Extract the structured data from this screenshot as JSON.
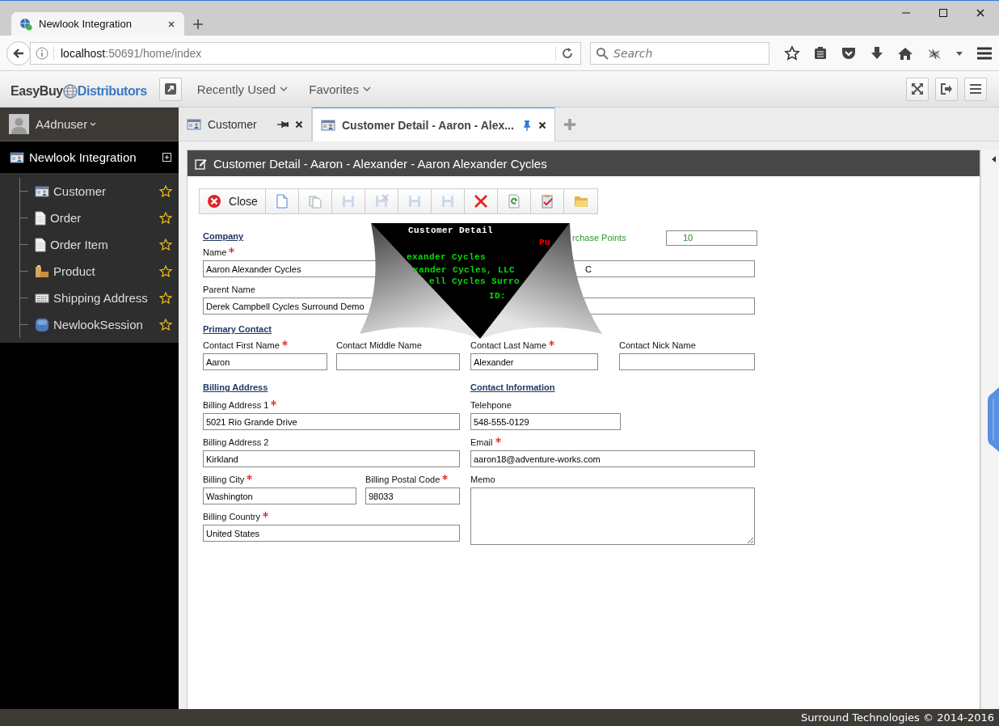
{
  "browser": {
    "tab_title": "Newlook Integration",
    "url_host": "localhost",
    "url_rest": ":50691/home/index",
    "search_placeholder": "Search"
  },
  "header": {
    "logo_left": "EasyBuy",
    "logo_right": "Distributors",
    "menus": [
      "Recently Used",
      "Favorites"
    ]
  },
  "user": {
    "name": "A4dnuser"
  },
  "sidebar": {
    "root": {
      "label": "Newlook Integration"
    },
    "items": [
      {
        "label": "Customer",
        "kind": "customer"
      },
      {
        "label": "Order",
        "kind": "document"
      },
      {
        "label": "Order Item",
        "kind": "document"
      },
      {
        "label": "Product",
        "kind": "boxes"
      },
      {
        "label": "Shipping Address",
        "kind": "keyboard"
      },
      {
        "label": "NewlookSession",
        "kind": "database"
      }
    ]
  },
  "tabs": [
    {
      "label": "Customer",
      "selected": false,
      "pinned": false
    },
    {
      "label": "Customer Detail - Aaron - Alex...",
      "selected": true,
      "pinned": true
    }
  ],
  "form": {
    "title": "Customer Detail - Aaron - Alexander - Aaron Alexander Cycles",
    "toolbar": [
      {
        "kind": "close",
        "label": "Close",
        "disabled": false
      },
      {
        "kind": "new",
        "disabled": false
      },
      {
        "kind": "copy",
        "disabled": false
      },
      {
        "kind": "save",
        "disabled": true
      },
      {
        "kind": "save-delete",
        "disabled": true
      },
      {
        "kind": "save",
        "disabled": true
      },
      {
        "kind": "save",
        "disabled": true
      },
      {
        "kind": "delete",
        "disabled": false
      },
      {
        "kind": "refresh",
        "disabled": false
      },
      {
        "kind": "checklist",
        "disabled": false
      },
      {
        "kind": "open",
        "disabled": false
      }
    ],
    "company": {
      "heading": "Company",
      "fields": [
        {
          "kind": "text",
          "label": "Name",
          "required": true,
          "value": "Aaron Alexander Cycles"
        },
        {
          "kind": "text",
          "label": "Parent Name",
          "required": false,
          "value": "Derek Campbell Cycles Surround Demo"
        }
      ]
    },
    "company_right": {
      "points_label": "rchase Points",
      "points_value": "10",
      "fields": [
        {
          "kind": "text",
          "value": "C"
        },
        {
          "kind": "text"
        }
      ]
    },
    "primary_contact": {
      "heading": "Primary Contact",
      "fields": [
        {
          "kind": "text",
          "label": "Contact First Name",
          "required": true,
          "value": "Aaron"
        },
        {
          "kind": "text",
          "label": "Contact Middle Name",
          "required": false
        },
        {
          "kind": "text",
          "label": "Contact Last Name",
          "required": true,
          "value": "Alexander"
        },
        {
          "kind": "text",
          "label": "Contact Nick Name",
          "required": false
        }
      ]
    },
    "billing_address": {
      "heading": "Billing Address",
      "fields": [
        {
          "kind": "text",
          "label": "Billing Address 1",
          "required": true,
          "value": "5021 Rio Grande Drive"
        },
        {
          "kind": "text",
          "label": "Billing Address 2",
          "required": false,
          "value": "Kirkland"
        },
        {
          "kind": "text",
          "label": "Billing City",
          "required": true,
          "value": "Washington"
        },
        {
          "kind": "text",
          "label": "Billing Postal Code",
          "required": true,
          "value": "98033"
        },
        {
          "kind": "text",
          "label": "Billing Country",
          "required": true,
          "value": "United States"
        }
      ]
    },
    "contact_information": {
      "heading": "Contact Information",
      "fields": [
        {
          "kind": "text",
          "label": "Telehpone",
          "required": false,
          "value": "548-555-0129"
        },
        {
          "kind": "text",
          "label": "Email",
          "required": true,
          "value": "aaron18@adventure-works.com"
        },
        {
          "kind": "textarea",
          "label": "Memo",
          "required": false
        }
      ]
    }
  },
  "terminal": {
    "lines": [
      {
        "text": "Customer Detail",
        "color": "#ffffff"
      },
      {
        "text": "Pu",
        "color": "#ff0000"
      },
      {
        "text": "exander Cycles",
        "color": "#00dd00"
      },
      {
        "text": "xander Cycles, LLC",
        "color": "#00dd00"
      },
      {
        "text": "ell Cycles Surro",
        "color": "#00dd00"
      },
      {
        "text": "ID:",
        "color": "#00dd00"
      }
    ]
  },
  "footer": {
    "text": "Surround Technologies © 2014-2016"
  }
}
